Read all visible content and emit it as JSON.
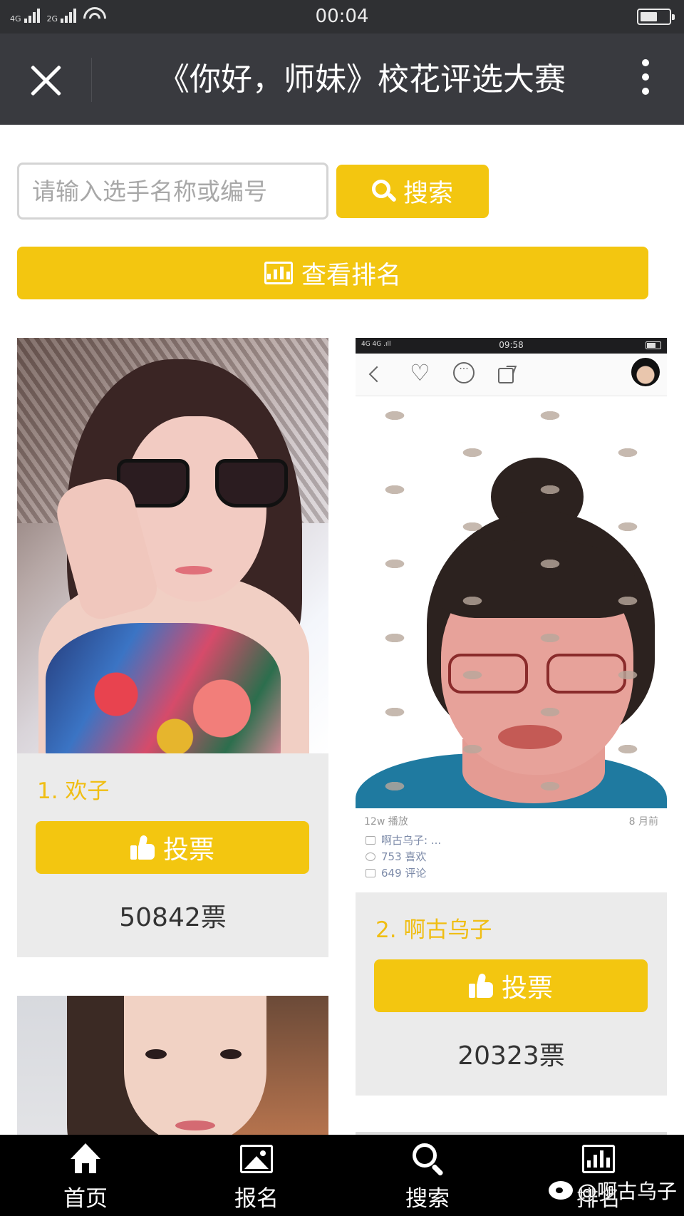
{
  "status_bar": {
    "network1": "4G",
    "network2": "2G",
    "time": "00:04",
    "battery_level": 0.6
  },
  "header": {
    "title": "《你好，师妹》校花评选大赛",
    "close_icon": "close-icon",
    "more_icon": "more-vertical-icon"
  },
  "search": {
    "placeholder": "请输入选手名称或编号",
    "value": "",
    "button_label": "搜索",
    "button_icon": "search-icon"
  },
  "ranking_button": {
    "label": "查看排名",
    "icon": "bar-chart-icon"
  },
  "contestants": [
    {
      "name": "1. 欢子",
      "vote_label": "投票",
      "votes": "50842票"
    },
    {
      "name": "2. 啊古乌子",
      "vote_label": "投票",
      "votes": "20323票",
      "embedded_screenshot": {
        "time": "09:58",
        "plays": "12w 播放",
        "age": "8 月前",
        "author": "啊古乌子: ...",
        "likes": "753 喜欢",
        "comments": "649 评论"
      }
    }
  ],
  "bottom_nav": [
    {
      "label": "首页",
      "icon": "home-icon"
    },
    {
      "label": "报名",
      "icon": "image-icon"
    },
    {
      "label": "搜索",
      "icon": "search-icon"
    },
    {
      "label": "排名",
      "icon": "bar-chart-icon"
    }
  ],
  "watermark": "@啊古乌子",
  "colors": {
    "accent": "#f3c610",
    "name_text": "#f0be13",
    "title_bar": "#393a3f",
    "status_bar": "#2f3033",
    "card_bg": "#ebebeb",
    "nav_bg": "#000000"
  }
}
